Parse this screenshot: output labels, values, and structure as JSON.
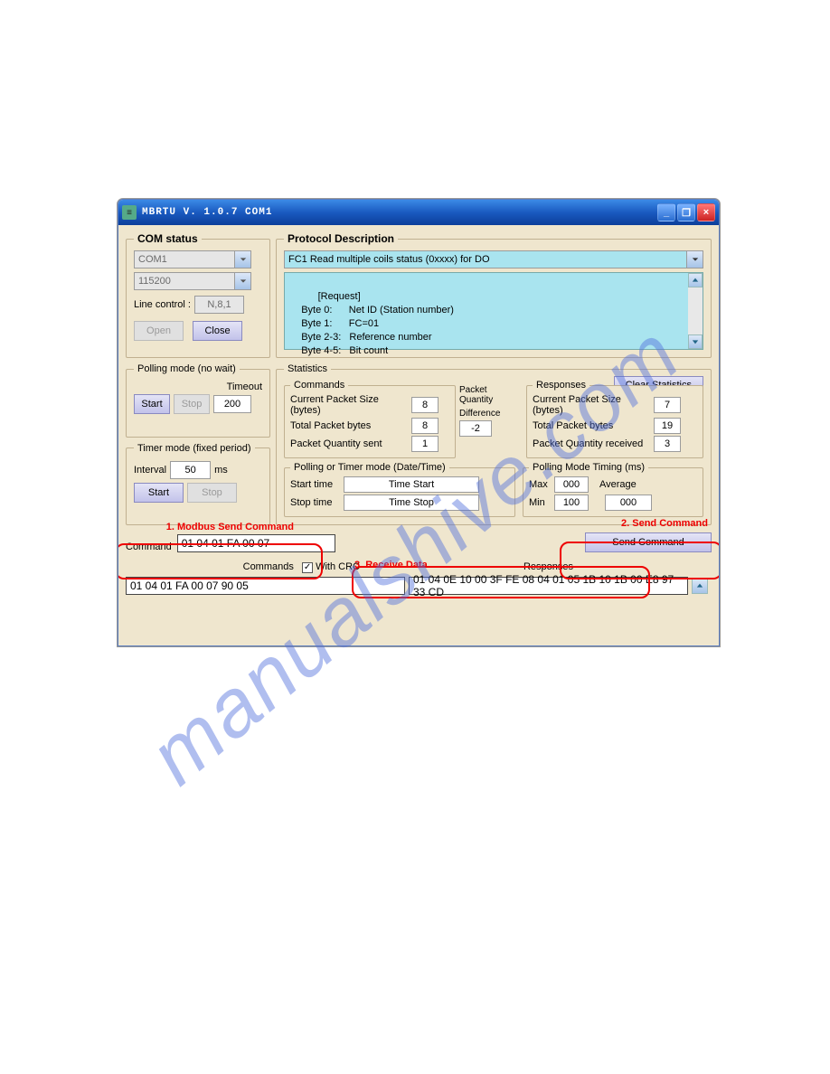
{
  "window": {
    "title": "MBRTU  V. 1.0.7  COM1",
    "minimize": "_",
    "restore": "❐",
    "close": "×"
  },
  "com_status": {
    "legend": "COM status",
    "port": "COM1",
    "baud": "115200",
    "line_control_label": "Line control :",
    "line_control_value": "N,8,1",
    "open_btn": "Open",
    "close_btn": "Close"
  },
  "protocol": {
    "legend": "Protocol Description",
    "selected": "FC1  Read multiple coils status (0xxxx)  for DO",
    "body": "[Request]\n    Byte 0:      Net ID (Station number)\n    Byte 1:      FC=01\n    Byte 2-3:   Reference number\n    Byte 4-5:   Bit count"
  },
  "polling_mode": {
    "legend": "Polling mode (no wait)",
    "start": "Start",
    "stop": "Stop",
    "timeout_label": "Timeout",
    "timeout": "200"
  },
  "timer_mode": {
    "legend": "Timer mode (fixed period)",
    "interval_label": "Interval",
    "interval": "50",
    "ms": "ms",
    "start": "Start",
    "stop": "Stop"
  },
  "statistics": {
    "legend": "Statistics",
    "clear_btn": "Clear Statistics",
    "commands": {
      "legend": "Commands",
      "cps_label": "Current Packet Size (bytes)",
      "cps": "8",
      "tpb_label": "Total Packet bytes",
      "tpb": "8",
      "pqs_label": "Packet Quantity sent",
      "pqs": "1"
    },
    "packet": {
      "q_label": "Packet Quantity",
      "diff_label": "Difference",
      "diff": "-2"
    },
    "responses": {
      "legend": "Responses",
      "cps_label": "Current Packet Size (bytes)",
      "cps": "7",
      "tpb_label": "Total Packet bytes",
      "tpb": "19",
      "pqr_label": "Packet Quantity received",
      "pqr": "3"
    },
    "polling_time": {
      "legend": "Polling  or Timer mode  (Date/Time)",
      "start_label": "Start time",
      "start": "Time Start",
      "stop_label": "Stop time",
      "stop": "Time Stop"
    },
    "polling_ms": {
      "legend": "Polling Mode Timing (ms)",
      "max_label": "Max",
      "max": "000",
      "min_label": "Min",
      "min": "100",
      "avg_label": "Average",
      "avg": "000"
    }
  },
  "command": {
    "label": "Command",
    "value": "01 04 01 FA 00 07",
    "send_btn": "Send Command"
  },
  "bottom": {
    "commands_label": "Commands",
    "with_crc_label": "With CRC",
    "with_crc_checked": "✓",
    "responses_label": "Responses",
    "sent": "01 04 01 FA 00 07 90 05",
    "recv": "01 04 0E 10 00 3F FE 08 04 01 05 1B 10 1B 00 E8 97 33 CD"
  },
  "annotations": {
    "a1": "1. Modbus Send Command",
    "a2": "2. Send Command",
    "a3": "3. Receive Data"
  },
  "watermark": "manualshive.com"
}
